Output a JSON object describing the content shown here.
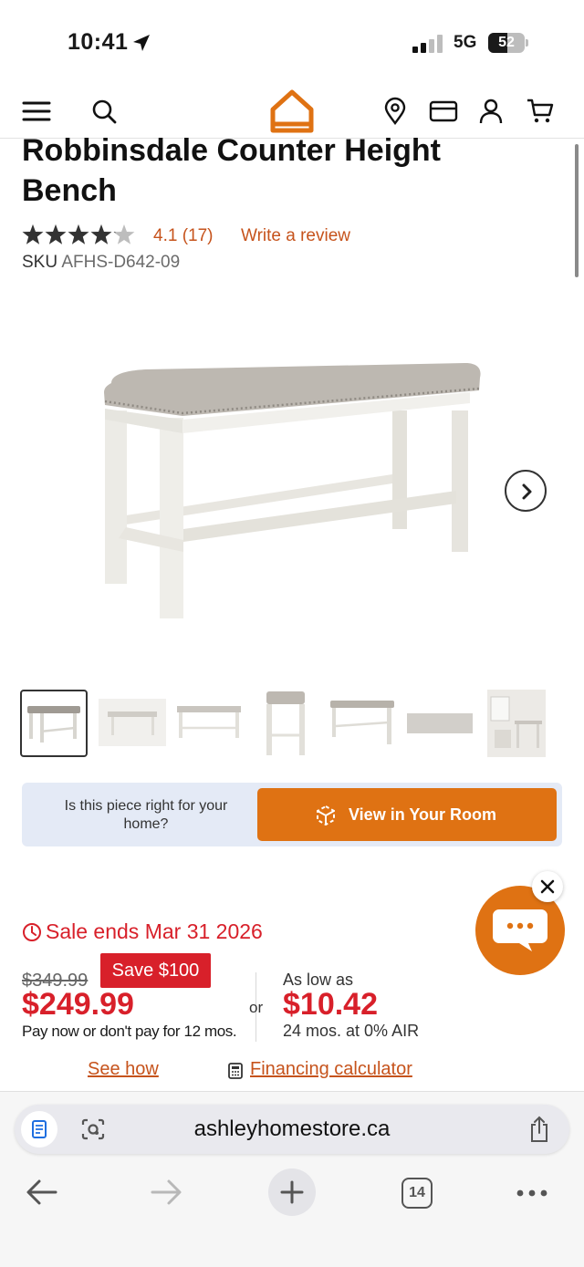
{
  "status_bar": {
    "time": "10:41",
    "network": "5G",
    "battery": "52",
    "battery_level": 0.52
  },
  "header": {
    "icons": [
      "menu-icon",
      "search-icon",
      "home-logo",
      "location-icon",
      "card-icon",
      "account-icon",
      "cart-icon"
    ],
    "brand_color": "#df7213"
  },
  "product": {
    "title": "Robbinsdale Counter Height Bench",
    "rating_value": 4.1,
    "rating_text": "4.1",
    "review_count": "(17)",
    "write_review": "Write a review",
    "sku_label": "SKU",
    "sku": "AFHS-D642-09",
    "thumbnail_count": 7
  },
  "ar": {
    "question": "Is this piece right for your home?",
    "button_label": "View in Your Room"
  },
  "pricing": {
    "sale_ends_prefix": "Sale ends",
    "sale_ends_date": "Mar 31 2026",
    "original_price": "$349.99",
    "save_label": "Save $100",
    "sale_price": "$249.99",
    "pay_later": "Pay now or don't pay for 12 mos.",
    "or": "or",
    "low_label": "As low as",
    "monthly": "$10.42",
    "terms": "24 mos. at 0% AIR",
    "see_how": "See how",
    "financing": "Financing calculator",
    "accent_red": "#d8202a",
    "link_orange": "#c6531c"
  },
  "browser": {
    "url": "ashleyhomestore.ca",
    "tabs_count": "14"
  }
}
